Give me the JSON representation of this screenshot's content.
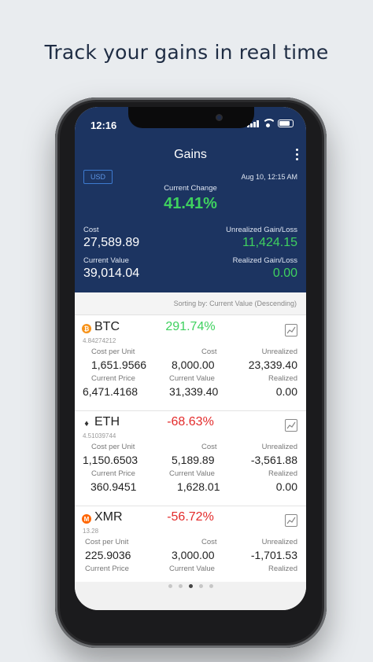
{
  "headline": "Track your gains in real time",
  "status": {
    "time": "12:16"
  },
  "header": {
    "title": "Gains",
    "currency_button": "USD",
    "date": "Aug 10, 12:15 AM",
    "current_change_label": "Current Change",
    "current_change_value": "41.41%",
    "cost_label": "Cost",
    "cost_value": "27,589.89",
    "unrealized_label": "Unrealized Gain/Loss",
    "unrealized_value": "11,424.15",
    "current_value_label": "Current Value",
    "current_value_value": "39,014.04",
    "realized_label": "Realized Gain/Loss",
    "realized_value": "0.00"
  },
  "sort_text": "Sorting by: Current Value (Descending)",
  "coins": [
    {
      "symbol": "BTC",
      "quantity": "4.84274212",
      "change": "291.74%",
      "cost_per_unit_label": "Cost per Unit",
      "cost_per_unit": "1,651.9566",
      "cost_label": "Cost",
      "cost": "8,000.00",
      "unrealized_label": "Unrealized",
      "unrealized": "23,339.40",
      "current_price_label": "Current Price",
      "current_price": "6,471.4168",
      "current_value_label": "Current Value",
      "current_value": "31,339.40",
      "realized_label": "Realized",
      "realized": "0.00"
    },
    {
      "symbol": "ETH",
      "quantity": "4.51039744",
      "change": "-68.63%",
      "cost_per_unit_label": "Cost per Unit",
      "cost_per_unit": "1,150.6503",
      "cost_label": "Cost",
      "cost": "5,189.89",
      "unrealized_label": "Unrealized",
      "unrealized": "-3,561.88",
      "current_price_label": "Current Price",
      "current_price": "360.9451",
      "current_value_label": "Current Value",
      "current_value": "1,628.01",
      "realized_label": "Realized",
      "realized": "0.00"
    },
    {
      "symbol": "XMR",
      "quantity": "13.28",
      "change": "-56.72%",
      "cost_per_unit_label": "Cost per Unit",
      "cost_per_unit": "225.9036",
      "cost_label": "Cost",
      "cost": "3,000.00",
      "unrealized_label": "Unrealized",
      "unrealized": "-1,701.53",
      "current_price_label": "Current Price",
      "current_value_label": "Current Value",
      "realized_label": "Realized"
    }
  ],
  "icons": {
    "btc": "bitcoin-icon",
    "eth": "ethereum-icon",
    "xmr": "monero-icon",
    "chart": "line-chart-icon",
    "menu": "more-vertical-icon"
  },
  "colors": {
    "header_bg": "#1c3461",
    "positive": "#3fd15f",
    "negative": "#e32b2b",
    "btc": "#f7931a",
    "xmr": "#ff6600"
  },
  "pager": {
    "pages": 5,
    "active_index": 2
  }
}
